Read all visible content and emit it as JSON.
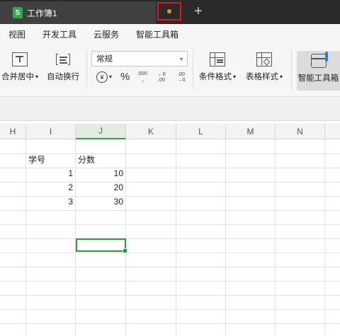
{
  "workbook": {
    "title": "工作簿1"
  },
  "menu": [
    "视图",
    "开发工具",
    "云服务",
    "智能工具箱"
  ],
  "ribbon": {
    "merge_center": "合并居中",
    "wrap_text": "自动换行",
    "number_format": "常规",
    "currency_symbol": "¥",
    "percent_symbol": "%",
    "thousands_symbol": "000",
    "inc_decimal": "←0 .00",
    "dec_decimal": ".00 →0",
    "conditional_format": "条件格式",
    "table_style": "表格样式",
    "smart_toolbox": "智能工具箱"
  },
  "sheet": {
    "columns": [
      "H",
      "I",
      "J",
      "K",
      "L",
      "M",
      "N"
    ],
    "selected_column": "J",
    "headers": {
      "I": "学号",
      "J": "分数"
    },
    "rows": [
      {
        "I": "1",
        "J": "10"
      },
      {
        "I": "2",
        "J": "20"
      },
      {
        "I": "3",
        "J": "30"
      }
    ]
  },
  "colors": {
    "accent": "#2f9a3c",
    "title_bar": "#2a2a2a",
    "unsaved_highlight": "#e01515"
  }
}
